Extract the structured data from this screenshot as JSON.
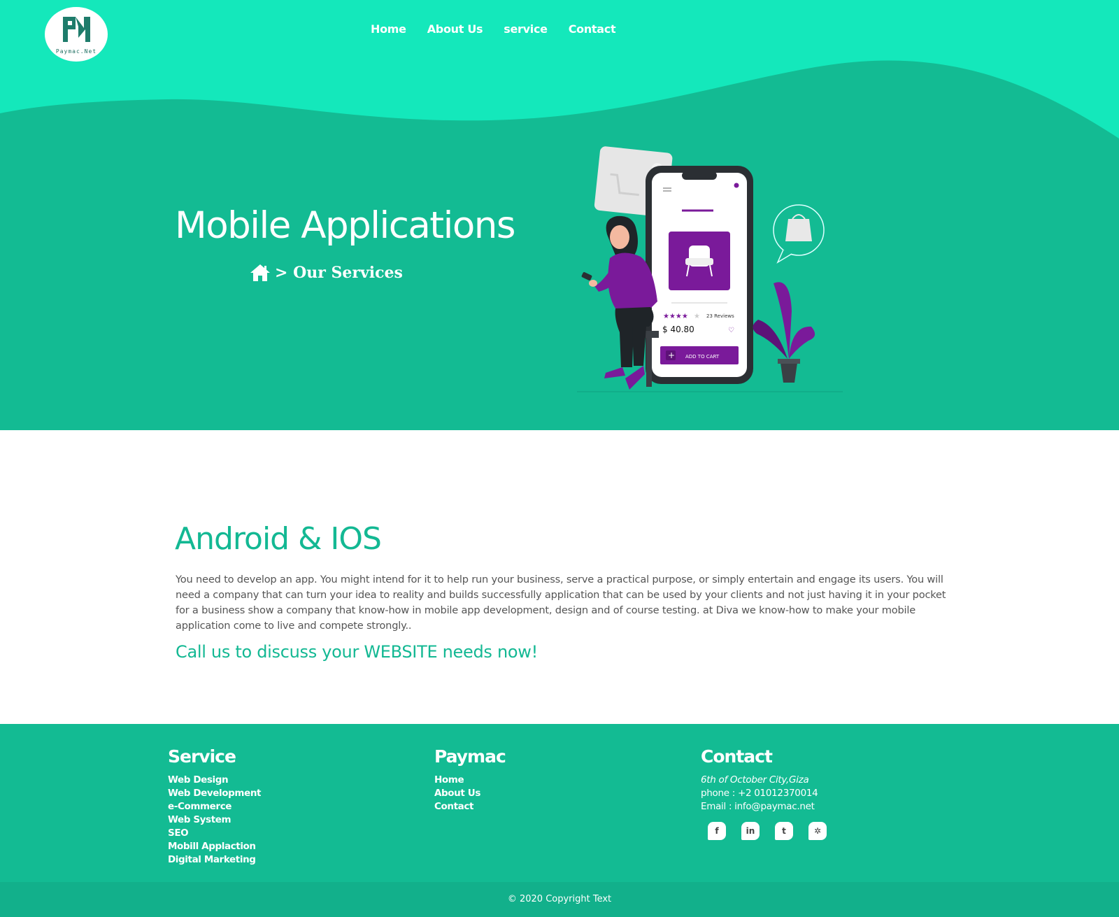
{
  "brand": {
    "logo_text": "Paymac.Net"
  },
  "nav": {
    "items": [
      {
        "label": "Home"
      },
      {
        "label": "About Us"
      },
      {
        "label": "service"
      },
      {
        "label": "Contact"
      }
    ]
  },
  "hero": {
    "title": "Mobile Applications",
    "breadcrumb": "> Our Services",
    "illustration": {
      "reviews": "23 Reviews",
      "price": "$ 40.80",
      "cart_button": "ADD TO CART"
    }
  },
  "main": {
    "title": "Android & IOS",
    "description": "You need to develop an app. You might intend for it to help run your business, serve a practical purpose, or simply entertain and engage its users. You will need a company that can turn your idea to reality and builds successfully application that can be used by your clients and not just having it in your pocket for a business show a company that know-how in mobile app development, design and of course testing. at Diva we know-how to make your mobile application come to live and compete strongly..",
    "cta": "Call us to discuss your WEBSITE needs now!"
  },
  "footer": {
    "service": {
      "title": "Service",
      "links": [
        {
          "label": "Web Design"
        },
        {
          "label": "Web Development"
        },
        {
          "label": "e-Commerce"
        },
        {
          "label": "Web System"
        },
        {
          "label": "SEO"
        },
        {
          "label": "Mobill Applaction"
        },
        {
          "label": "Digital Marketing"
        }
      ]
    },
    "paymac": {
      "title": "Paymac",
      "links": [
        {
          "label": "Home"
        },
        {
          "label": "About Us"
        },
        {
          "label": "Contact"
        }
      ]
    },
    "contact": {
      "title": "Contact",
      "address": "6th of October City,Giza",
      "phone": "phone : +2 01012370014",
      "email": "Email : info@paymac.net",
      "socials": [
        {
          "name": "facebook",
          "glyph": "f"
        },
        {
          "name": "linkedin",
          "glyph": "in"
        },
        {
          "name": "twitter",
          "glyph": "t"
        },
        {
          "name": "settings",
          "glyph": "✲"
        }
      ]
    }
  },
  "copyright": "© 2020 Copyright Text",
  "colors": {
    "primary": "#13bb93",
    "wave_light": "#14e8bb",
    "accent_purple": "#7a1a9a",
    "footer_bottom": "#12b08b"
  }
}
